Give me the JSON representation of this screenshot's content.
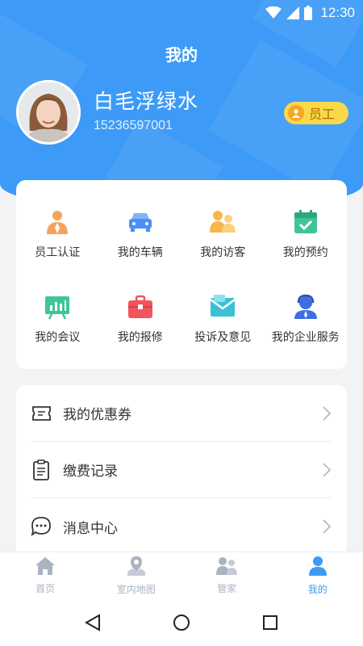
{
  "status_bar": {
    "time": "12:30"
  },
  "header": {
    "title": "我的",
    "user_name": "白毛浮绿水",
    "phone": "15236597001",
    "role_badge": "员工"
  },
  "grid": [
    {
      "label": "员工认证",
      "icon": "employee-icon",
      "color": "#f5a25d"
    },
    {
      "label": "我的车辆",
      "icon": "car-icon",
      "color": "#4a90f5"
    },
    {
      "label": "我的访客",
      "icon": "visitors-icon",
      "color": "#f8b64c"
    },
    {
      "label": "我的预约",
      "icon": "calendar-check-icon",
      "color": "#3ec59a"
    },
    {
      "label": "我的会议",
      "icon": "meeting-board-icon",
      "color": "#3ec59a"
    },
    {
      "label": "我的报修",
      "icon": "toolbox-icon",
      "color": "#f2545b"
    },
    {
      "label": "投诉及意见",
      "icon": "envelope-icon",
      "color": "#3cc0d8"
    },
    {
      "label": "我的企业服务",
      "icon": "service-agent-icon",
      "color": "#3f6ee0"
    }
  ],
  "list": [
    {
      "label": "我的优惠券",
      "icon": "coupon-icon"
    },
    {
      "label": "缴费记录",
      "icon": "clipboard-icon"
    },
    {
      "label": "消息中心",
      "icon": "message-icon"
    }
  ],
  "tabs": [
    {
      "label": "首页",
      "icon": "home-icon",
      "active": false
    },
    {
      "label": "室内地图",
      "icon": "map-pin-icon",
      "active": false
    },
    {
      "label": "管家",
      "icon": "butler-icon",
      "active": false
    },
    {
      "label": "我的",
      "icon": "profile-icon",
      "active": true
    }
  ],
  "colors": {
    "primary": "#3d9bf7",
    "badge": "#f9d84a",
    "tab_inactive": "#aab3c2"
  }
}
